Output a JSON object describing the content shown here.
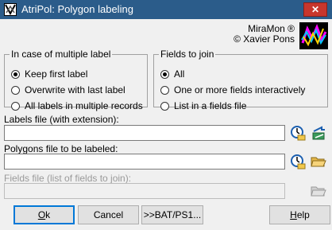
{
  "window": {
    "title": "AtriPol: Polygon labeling",
    "close_glyph": "✕"
  },
  "credits": {
    "line1": "MiraMon ®",
    "line2": "© Xavier Pons"
  },
  "multiple_label": {
    "legend": "In case of multiple label",
    "options": [
      "Keep first label",
      "Overwrite with last label",
      "All labels in multiple records"
    ],
    "selected": 0
  },
  "fields_to_join": {
    "legend": "Fields to join",
    "options": [
      "All",
      "One or more fields interactively",
      "List in a fields file"
    ],
    "selected": 0
  },
  "labels_file": {
    "label": "Labels file (with extension):",
    "value": ""
  },
  "polygons_file": {
    "label": "Polygons file to be labeled:",
    "value": ""
  },
  "fields_file": {
    "label": "Fields file (list of fields to join):",
    "value": ""
  },
  "buttons": {
    "ok": {
      "first": "O",
      "rest": "k"
    },
    "cancel": "Cancel",
    "bat": ">>BAT/PS1...",
    "help": {
      "first": "H",
      "rest": "elp"
    }
  },
  "icons": [
    "clock-icon",
    "folder-open-icon",
    "swap-arrows-icon",
    "miramon-logo"
  ]
}
